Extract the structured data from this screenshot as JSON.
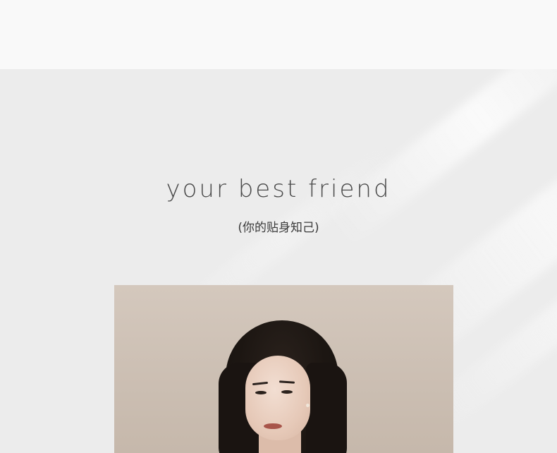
{
  "hero": {
    "headline": "your best friend",
    "subline": "(你的贴身知己)"
  },
  "colors": {
    "top_band": "#f9f9f9",
    "hero_background": "#ececec",
    "headline_text": "#4a4a4a",
    "photo_background": "#cfc3b8"
  }
}
